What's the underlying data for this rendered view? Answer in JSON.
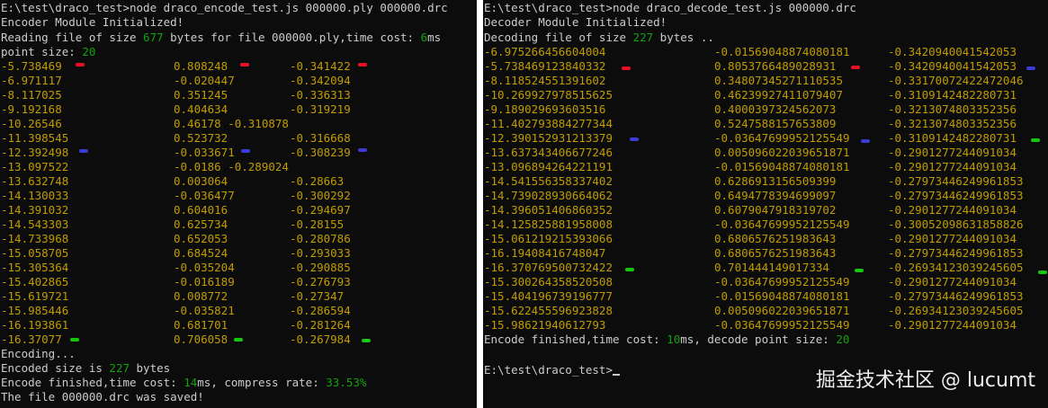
{
  "left": {
    "prompt": "E:\\test\\draco_test>node draco_encode_test.js 000000.ply 000000.drc",
    "init_msg": "Encoder Module Initialized!",
    "read_prefix": "Reading file of size ",
    "read_size": "677",
    "read_mid": " bytes for file 000000.ply,time cost: ",
    "read_time": "6",
    "read_suffix": "ms",
    "point_prefix": "point size: ",
    "point_count": "20",
    "points": [
      [
        "-5.738469",
        "0.808248",
        "-0.341422"
      ],
      [
        "-6.971117",
        "-0.020447",
        "-0.342094"
      ],
      [
        "-8.117025",
        "0.351245",
        "-0.336313"
      ],
      [
        "-9.192168",
        "0.404634",
        "-0.319219"
      ],
      [
        "-10.26546",
        "0.46178 -0.310878",
        ""
      ],
      [
        "-11.398545",
        "0.523732",
        "-0.316668"
      ],
      [
        "-12.392498",
        "-0.033671",
        "-0.308239"
      ],
      [
        "-13.097522",
        "-0.0186 -0.289024",
        ""
      ],
      [
        "-13.632748",
        "0.003064",
        "-0.28663"
      ],
      [
        "-14.130033",
        "-0.036477",
        "-0.300292"
      ],
      [
        "-14.391032",
        "0.604016",
        "-0.294697"
      ],
      [
        "-14.543303",
        "0.625734",
        "-0.28155"
      ],
      [
        "-14.733968",
        "0.652053",
        "-0.280786"
      ],
      [
        "-15.058705",
        "0.684524",
        "-0.293033"
      ],
      [
        "-15.305364",
        "-0.035204",
        "-0.290885"
      ],
      [
        "-15.402865",
        "-0.016189",
        "-0.276793"
      ],
      [
        "-15.619721",
        "0.008772",
        "-0.27347"
      ],
      [
        "-15.985446",
        "-0.035821",
        "-0.286594"
      ],
      [
        "-16.193861",
        "0.681701",
        "-0.281264"
      ],
      [
        "-16.37077",
        "0.706058",
        "-0.267984"
      ]
    ],
    "encoding": "Encoding...",
    "enc_prefix": "Encoded size is ",
    "enc_size": "227",
    "enc_suffix": " bytes",
    "fin_prefix": "Encode finished,time cost: ",
    "fin_time": "14",
    "fin_mid": "ms, compress rate: ",
    "fin_rate": "33.53%",
    "saved": "The file 000000.drc was saved!"
  },
  "right": {
    "prompt": "E:\\test\\draco_test>node draco_decode_test.js 000000.drc",
    "init_msg": "Decoder Module Initialized!",
    "dec_prefix": "Decoding file of size ",
    "dec_size": "227",
    "dec_suffix": " bytes ..",
    "points": [
      [
        "-6.975266456604004",
        "-0.01569048874080181",
        "-0.3420940041542053"
      ],
      [
        "-5.738469123840332",
        "0.8053766489028931",
        "-0.3420940041542053"
      ],
      [
        "-8.118524551391602",
        "0.34807345271110535",
        "-0.33170072422472046"
      ],
      [
        "-10.269927978515625",
        "0.46239927411079407",
        "-0.3109142482280731"
      ],
      [
        "-9.189029693603516",
        "0.4000397324562073",
        "-0.3213074803352356"
      ],
      [
        "-11.402793884277344",
        "0.5247588157653809",
        "-0.3213074803352356"
      ],
      [
        "-12.390152931213379",
        "-0.03647699952125549",
        "-0.3109142482280731"
      ],
      [
        "-13.637343406677246",
        "0.005096022039651871",
        "-0.2901277244091034"
      ],
      [
        "-13.096894264221191",
        "-0.01569048874080181",
        "-0.2901277244091034"
      ],
      [
        "-14.541556358337402",
        "0.6286913156509399",
        "-0.27973446249961853"
      ],
      [
        "-14.739028930664062",
        "0.6494778394699097",
        "-0.27973446249961853"
      ],
      [
        "-14.396051406860352",
        "0.6079047918319702",
        "-0.2901277244091034"
      ],
      [
        "-14.125825881958008",
        "-0.03647699952125549",
        "-0.30052098631858826"
      ],
      [
        "-15.061219215393066",
        "0.6806576251983643",
        "-0.2901277244091034"
      ],
      [
        "-16.19408416748047",
        "0.6806576251983643",
        "-0.27973446249961853"
      ],
      [
        "-16.370769500732422",
        "0.701444149017334",
        "-0.26934123039245605"
      ],
      [
        "-15.300264358520508",
        "-0.03647699952125549",
        "-0.2901277244091034"
      ],
      [
        "-15.404196739196777",
        "-0.01569048874080181",
        "-0.27973446249961853"
      ],
      [
        "-15.622455596923828",
        "0.005096022039651871",
        "-0.26934123039245605"
      ],
      [
        "-15.98621940612793",
        "-0.03647699952125549",
        "-0.2901277244091034"
      ]
    ],
    "fin_prefix": "Encode finished,time cost: ",
    "fin_time": "10",
    "fin_mid": "ms, decode point size: ",
    "fin_points": "20",
    "prompt2": "E:\\test\\draco_test>"
  },
  "watermark": "掘金技术社区 @ lucumt",
  "colors": {
    "background": "#0c0c0c",
    "text": "#cccccc",
    "number": "#c19c00",
    "highlight": "#13a10e",
    "marker_red": "#e81123",
    "marker_blue": "#3b3bd6",
    "marker_green": "#16c60c"
  }
}
